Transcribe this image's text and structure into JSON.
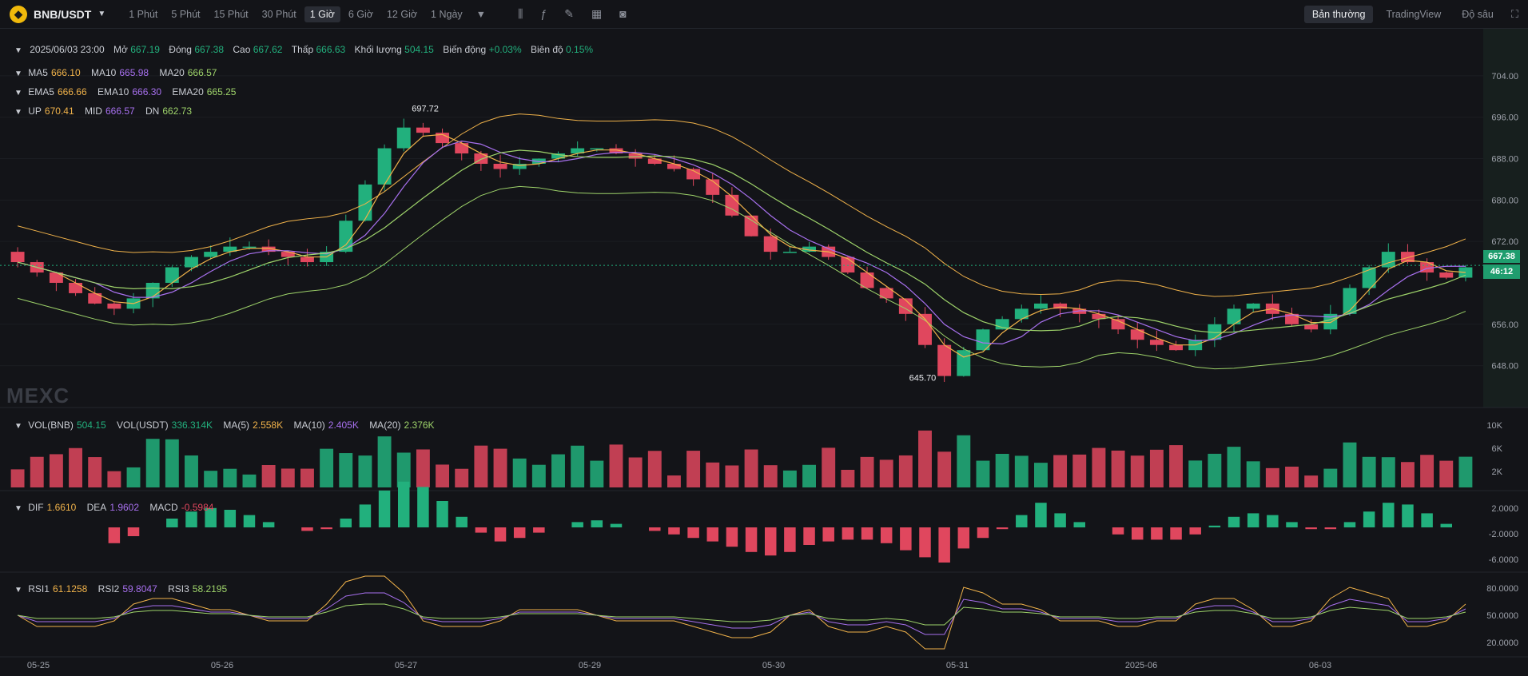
{
  "toolbar": {
    "pair": "BNB/USDT",
    "intervals": [
      "1 Phút",
      "5 Phút",
      "15 Phút",
      "30 Phút",
      "1 Giờ",
      "6 Giờ",
      "12 Giờ",
      "1 Ngày"
    ],
    "active_interval": "1 Giờ",
    "views": [
      "Bản thường",
      "TradingView",
      "Độ sâu"
    ],
    "active_view": "Bản thường"
  },
  "ohlc": {
    "date": "2025/06/03 23:00",
    "open_label": "Mở",
    "open": "667.19",
    "close_label": "Đóng",
    "close": "667.38",
    "high_label": "Cao",
    "high": "667.62",
    "low_label": "Thấp",
    "low": "666.63",
    "volume_label": "Khối lượng",
    "volume": "504.15",
    "change_label": "Biến động",
    "change": "+0.03%",
    "amplitude_label": "Biên độ",
    "amplitude": "0.15%"
  },
  "ma": {
    "ma5_label": "MA5",
    "ma5": "666.10",
    "ma10_label": "MA10",
    "ma10": "665.98",
    "ma20_label": "MA20",
    "ma20": "666.57"
  },
  "ema": {
    "ema5_label": "EMA5",
    "ema5": "666.66",
    "ema10_label": "EMA10",
    "ema10": "666.30",
    "ema20_label": "EMA20",
    "ema20": "665.25"
  },
  "boll": {
    "up_label": "UP",
    "up": "670.41",
    "mid_label": "MID",
    "mid": "666.57",
    "dn_label": "DN",
    "dn": "662.73"
  },
  "vol": {
    "vol_bnb_label": "VOL(BNB)",
    "vol_bnb": "504.15",
    "vol_usdt_label": "VOL(USDT)",
    "vol_usdt": "336.314K",
    "ma5_label": "MA(5)",
    "ma5": "2.558K",
    "ma10_label": "MA(10)",
    "ma10": "2.405K",
    "ma20_label": "MA(20)",
    "ma20": "2.376K"
  },
  "macd": {
    "dif_label": "DIF",
    "dif": "1.6610",
    "dea_label": "DEA",
    "dea": "1.9602",
    "macd_label": "MACD",
    "macd": "-0.5984"
  },
  "rsi": {
    "rsi1_label": "RSI1",
    "rsi1": "61.1258",
    "rsi2_label": "RSI2",
    "rsi2": "59.8047",
    "rsi3_label": "RSI3",
    "rsi3": "58.2195"
  },
  "price_axis": [
    "704.00",
    "696.00",
    "688.00",
    "680.00",
    "672.00",
    "656.00",
    "648.00"
  ],
  "vol_axis": [
    "10K",
    "6K",
    "2K"
  ],
  "macd_axis": [
    "2.0000",
    "-2.0000",
    "-6.0000"
  ],
  "rsi_axis": [
    "80.0000",
    "50.0000",
    "20.0000"
  ],
  "time_axis": [
    "05-25",
    "05-26",
    "05-27",
    "05-29",
    "05-30",
    "05-31",
    "2025-06",
    "06-03"
  ],
  "annotations": {
    "high": "697.72",
    "low": "645.70"
  },
  "current_price": "667.38",
  "countdown": "46:12",
  "watermark": "MEXC",
  "colors": {
    "up": "#22b07d",
    "down": "#e0475e",
    "ma5": "#f0b24a",
    "ma10": "#a770ee",
    "ma20": "#9ed36a",
    "bg": "#131418"
  },
  "chart_data": {
    "type": "candlestick",
    "symbol": "BNB/USDT",
    "interval": "1 Giờ",
    "ylim": [
      643,
      710
    ],
    "x_ticks": [
      "05-25",
      "05-26",
      "05-27",
      "05-29",
      "05-30",
      "05-31",
      "2025-06",
      "06-03"
    ],
    "closes": [
      668,
      666,
      664,
      662,
      660,
      659,
      661,
      664,
      667,
      669,
      670,
      671,
      671,
      670,
      669,
      668,
      670,
      676,
      683,
      690,
      694,
      693,
      691,
      689,
      687,
      686,
      687,
      688,
      689,
      690,
      690,
      689,
      688,
      687,
      686,
      684,
      681,
      677,
      673,
      670,
      670,
      671,
      669,
      666,
      663,
      661,
      658,
      652,
      646,
      651,
      655,
      657,
      659,
      660,
      659,
      658,
      657,
      655,
      653,
      652,
      651,
      653,
      656,
      659,
      660,
      658,
      656,
      655,
      658,
      663,
      667,
      670,
      668,
      666,
      665,
      667
    ],
    "current_price": 667.38,
    "annotated_high": 697.72,
    "annotated_low": 645.7
  }
}
